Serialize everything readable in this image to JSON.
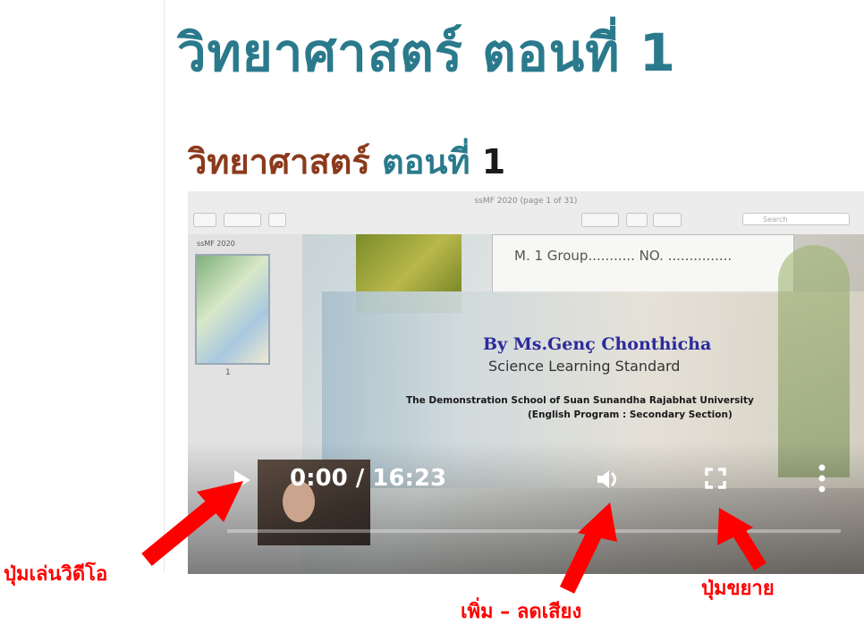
{
  "page": {
    "title": "วิทยาศาสตร์ ตอนที่ 1",
    "subtitle_part_a": "วิทยาศาสตร์",
    "subtitle_part_b": "ตอนที่",
    "subtitle_part_c": "1"
  },
  "video": {
    "pdf_title": "ssMF 2020 (page 1 of 31)",
    "sidebar_name": "ssMF 2020",
    "thumb_number": "1",
    "search_placeholder": "Search",
    "group_text": "M. 1 Group........... NO. ...............",
    "by_line": "By Ms.Genç Chonthicha",
    "standard_line": "Science Learning Standard",
    "school_line": "The Demonstration School of Suan Sunandha Rajabhat University",
    "program_line": "(English Program : Secondary Section)",
    "time": "0:00 / 16:23",
    "progress": 0,
    "icons": [
      "play-icon",
      "volume-icon",
      "fullscreen-icon",
      "more-icon"
    ]
  },
  "callouts": {
    "play": "ปุ่มเล่นวิดีโอ",
    "volume": "เพิ่ม – ลดเสียง",
    "fullscreen": "ปุ่มขยาย"
  },
  "colors": {
    "title": "#2a7a8c",
    "subtitle_accent": "#8b3a1c",
    "callout": "#ff0000"
  }
}
